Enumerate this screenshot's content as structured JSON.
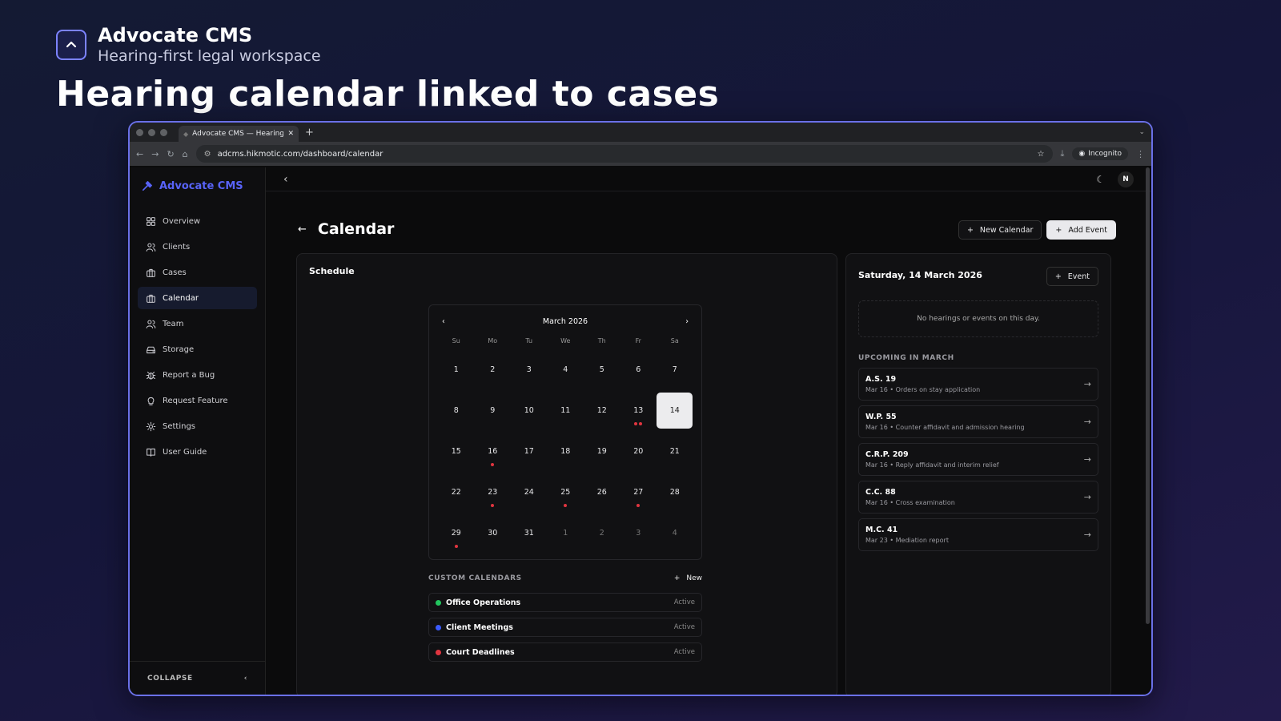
{
  "brand": {
    "title": "Advocate CMS",
    "subtitle": "Hearing-first legal workspace"
  },
  "headline": "Hearing calendar linked to cases",
  "browser": {
    "tab_title": "Advocate CMS — Hearing-Re",
    "url": "adcms.hikmotic.com/dashboard/calendar",
    "incognito": "Incognito"
  },
  "sidebar": {
    "brand": "Advocate CMS",
    "items": [
      {
        "label": "Overview",
        "icon": "grid-icon"
      },
      {
        "label": "Clients",
        "icon": "users-icon"
      },
      {
        "label": "Cases",
        "icon": "briefcase-icon"
      },
      {
        "label": "Calendar",
        "icon": "calendar-icon"
      },
      {
        "label": "Team",
        "icon": "team-icon"
      },
      {
        "label": "Storage",
        "icon": "storage-icon"
      },
      {
        "label": "Report a Bug",
        "icon": "bug-icon"
      },
      {
        "label": "Request Feature",
        "icon": "lightbulb-icon"
      },
      {
        "label": "Settings",
        "icon": "gear-icon"
      },
      {
        "label": "User Guide",
        "icon": "book-icon"
      }
    ],
    "active": "Calendar",
    "collapse": "COLLAPSE"
  },
  "topbar": {
    "avatar": "N"
  },
  "page": {
    "title": "Calendar",
    "new_calendar": "New Calendar",
    "add_event": "Add Event"
  },
  "schedule": {
    "title": "Schedule",
    "month": "March 2026",
    "weekdays": [
      "Su",
      "Mo",
      "Tu",
      "We",
      "Th",
      "Fr",
      "Sa"
    ],
    "days": [
      {
        "n": "1"
      },
      {
        "n": "2"
      },
      {
        "n": "3"
      },
      {
        "n": "4"
      },
      {
        "n": "5"
      },
      {
        "n": "6"
      },
      {
        "n": "7"
      },
      {
        "n": "8"
      },
      {
        "n": "9"
      },
      {
        "n": "10"
      },
      {
        "n": "11"
      },
      {
        "n": "12"
      },
      {
        "n": "13",
        "dots": 2
      },
      {
        "n": "14",
        "selected": true
      },
      {
        "n": "15"
      },
      {
        "n": "16",
        "dots": 1
      },
      {
        "n": "17"
      },
      {
        "n": "18"
      },
      {
        "n": "19"
      },
      {
        "n": "20"
      },
      {
        "n": "21"
      },
      {
        "n": "22"
      },
      {
        "n": "23",
        "dots": 1
      },
      {
        "n": "24"
      },
      {
        "n": "25",
        "dots": 1
      },
      {
        "n": "26"
      },
      {
        "n": "27",
        "dots": 1
      },
      {
        "n": "28"
      },
      {
        "n": "29",
        "dots": 1
      },
      {
        "n": "30"
      },
      {
        "n": "31"
      },
      {
        "n": "1",
        "muted": true
      },
      {
        "n": "2",
        "muted": true
      },
      {
        "n": "3",
        "muted": true
      },
      {
        "n": "4",
        "muted": true
      }
    ]
  },
  "custom_calendars": {
    "label": "CUSTOM CALENDARS",
    "new": "New",
    "items": [
      {
        "name": "Office Operations",
        "status": "Active",
        "color": "#22c55e"
      },
      {
        "name": "Client Meetings",
        "status": "Active",
        "color": "#3b5bfd"
      },
      {
        "name": "Court Deadlines",
        "status": "Active",
        "color": "#e0353f"
      }
    ]
  },
  "day_panel": {
    "title": "Saturday, 14 March 2026",
    "event_button": "Event",
    "empty": "No hearings or events on this day.",
    "upcoming_label": "UPCOMING IN MARCH",
    "upcoming": [
      {
        "case": "A.S. 19",
        "desc": "Mar 16 • Orders on stay application"
      },
      {
        "case": "W.P. 55",
        "desc": "Mar 16 • Counter affidavit and admission hearing"
      },
      {
        "case": "C.R.P. 209",
        "desc": "Mar 16 • Reply affidavit and interim relief"
      },
      {
        "case": "C.C. 88",
        "desc": "Mar 16 • Cross examination"
      },
      {
        "case": "M.C. 41",
        "desc": "Mar 23 • Mediation report"
      }
    ]
  },
  "colors": {
    "accent": "#5863f8",
    "dot": "#e0353f",
    "frame": "#6a70e8"
  }
}
